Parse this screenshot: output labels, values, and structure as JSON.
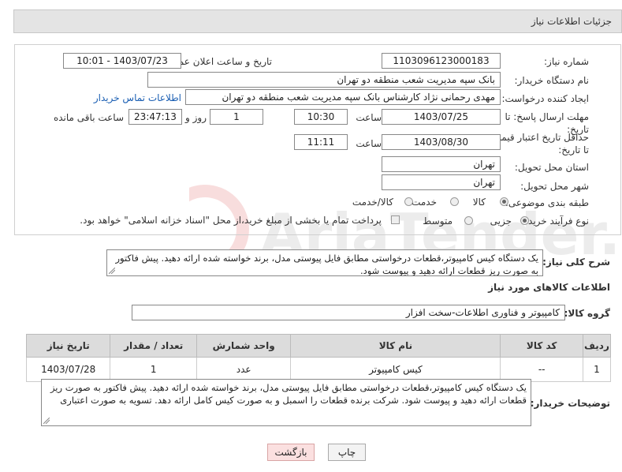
{
  "header": {
    "title": "جزئیات اطلاعات نیاز"
  },
  "form": {
    "need_number_label": "شماره نیاز:",
    "need_number": "1103096123000183",
    "announce_label": "تاریخ و ساعت اعلان عمومی:",
    "announce_value": "1403/07/23 - 10:01",
    "buyer_org_label": "نام دستگاه خریدار:",
    "buyer_org": "بانک سپه مدیریت شعب منطقه دو تهران",
    "creator_label": "ایجاد کننده درخواست:",
    "creator": "مهدی رحمانی نژاد کارشناس بانک سپه مدیریت شعب منطقه دو تهران",
    "contact_link": "اطلاعات تماس خریدار",
    "deadline_label": "مهلت ارسال پاسخ: تا تاریخ:",
    "deadline_date": "1403/07/25",
    "deadline_time_label": "ساعت",
    "deadline_time": "10:30",
    "days": "1",
    "days_label": "روز و",
    "remaining_time": "23:47:13",
    "remaining_label": "ساعت باقی مانده",
    "validity_label": "حداقل تاریخ اعتبار قیمت: تا تاریخ:",
    "validity_date": "1403/08/30",
    "validity_time_label": "ساعت",
    "validity_time": "11:11",
    "province_label": "استان محل تحویل:",
    "province": "تهران",
    "city_label": "شهر محل تحویل:",
    "city": "تهران",
    "category_label": "طبقه بندی موضوعی:",
    "category_options": [
      "کالا",
      "خدمت",
      "کالا/خدمت"
    ],
    "category_selected": "کالا",
    "process_label": "نوع فرآیند خرید :",
    "process_options": [
      "جزیی",
      "متوسط"
    ],
    "process_selected": "جزیی",
    "payment_note": "پرداخت تمام یا بخشی از مبلغ خرید،از محل \"اسناد خزانه اسلامی\" خواهد بود."
  },
  "description": {
    "label": "شرح کلی نیاز:",
    "text": "یک دستگاه کیس کامپیوتر،قطعات درخواستی مطابق فایل پیوستی مدل، برند خواسته شده ارائه دهید. پیش فاکتور به صورت ریز قطعات ارائه دهید و پیوست شود."
  },
  "goods": {
    "section_title": "اطلاعات کالاهای مورد نیاز",
    "group_label": "گروه کالا:",
    "group_value": "کامپیوتر و فناوری اطلاعات-سخت افزار",
    "columns": [
      "ردیف",
      "کد کالا",
      "نام کالا",
      "واحد شمارش",
      "تعداد / مقدار",
      "تاریخ نیاز"
    ],
    "rows": [
      {
        "index": "1",
        "code": "--",
        "name": "کیس کامپیوتر",
        "unit": "عدد",
        "qty": "1",
        "date": "1403/07/28"
      }
    ]
  },
  "buyer_notes": {
    "label": "توضیحات خریدار:",
    "text": "یک دستگاه کیس کامپیوتر،قطعات درخواستی مطابق فایل پیوستی مدل، برند خواسته شده ارائه دهید. پیش فاکتور به صورت ریز قطعات ارائه دهید و پیوست شود. شرکت برنده قطعات را اسمبل و به صورت کیس کامل ارائه دهد. تسویه به صورت اعتباری"
  },
  "buttons": {
    "print": "چاپ",
    "back": "بازگشت"
  },
  "watermark": {
    "text": "AriaTender.net"
  }
}
